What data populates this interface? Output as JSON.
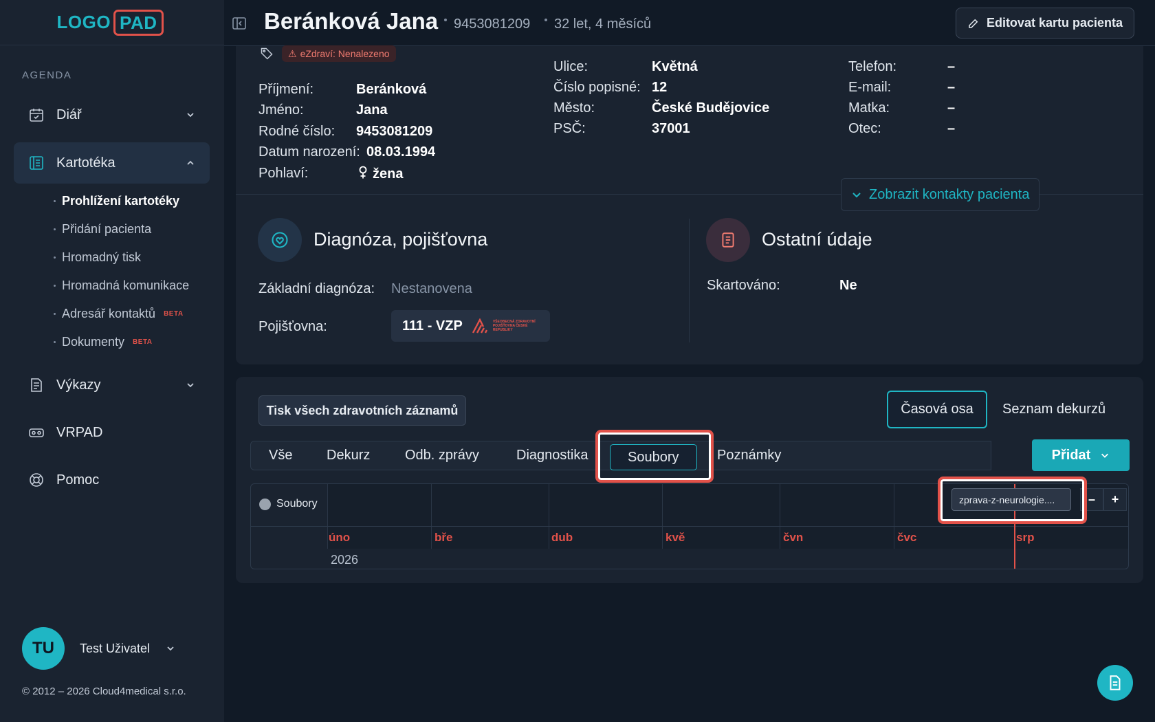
{
  "app": {
    "logo_part1": "LOGO",
    "logo_part2": "PAD"
  },
  "sidebar": {
    "section_label": "AGENDA",
    "items": [
      {
        "label": "Diář",
        "icon": "calendar-icon"
      },
      {
        "label": "Kartotéka",
        "icon": "cardfile-icon"
      },
      {
        "label": "Výkazy",
        "icon": "report-icon"
      },
      {
        "label": "VRPAD",
        "icon": "vr-icon"
      },
      {
        "label": "Pomoc",
        "icon": "lifebuoy-icon"
      }
    ],
    "sub_items": [
      {
        "label": "Prohlížení kartotéky"
      },
      {
        "label": "Přidání pacienta"
      },
      {
        "label": "Hromadný tisk"
      },
      {
        "label": "Hromadná komunikace"
      },
      {
        "label": "Adresář kontaktů",
        "badge": "BETA"
      },
      {
        "label": "Dokumenty",
        "badge": "BETA"
      }
    ],
    "user": {
      "initials": "TU",
      "name": "Test Uživatel"
    },
    "copyright": "© 2012 – 2026 Cloud4medical s.r.o."
  },
  "header": {
    "patient_name": "Beránková Jana",
    "birth_number": "9453081209",
    "age": "32 let, 4 měsíců",
    "edit_label": "Editovat kartu pacienta"
  },
  "patient": {
    "ezdravi": "eZdraví: Nenalezeno",
    "personal": [
      {
        "label": "Příjmení:",
        "value": "Beránková"
      },
      {
        "label": "Jméno:",
        "value": "Jana"
      },
      {
        "label": "Rodné číslo:",
        "value": "9453081209"
      },
      {
        "label": "Datum narození:",
        "value": "08.03.1994"
      },
      {
        "label": "Pohlaví:",
        "value": "žena"
      }
    ],
    "address": [
      {
        "label": "Ulice:",
        "value": "Květná"
      },
      {
        "label": "Číslo popisné:",
        "value": "12"
      },
      {
        "label": "Město:",
        "value": "České Budějovice"
      },
      {
        "label": "PSČ:",
        "value": "37001"
      }
    ],
    "contacts": [
      {
        "label": "Telefon:",
        "value": "–"
      },
      {
        "label": "E-mail:",
        "value": "–"
      },
      {
        "label": "Matka:",
        "value": "–"
      },
      {
        "label": "Otec:",
        "value": "–"
      }
    ],
    "show_contacts_label": "Zobrazit kontakty pacienta"
  },
  "diagnosis": {
    "title": "Diagnóza, pojišťovna",
    "base_label": "Základní diagnóza:",
    "base_value": "Nestanovena",
    "insurance_label": "Pojišťovna:",
    "insurance_value": "111 - VZP",
    "insurance_logo_text": "VŠEOBECNÁ ZDRAVOTNÍ POJIŠŤOVNA ČESKÉ REPUBLIKY"
  },
  "other": {
    "title": "Ostatní údaje",
    "shredded_label": "Skartováno:",
    "shredded_value": "Ne"
  },
  "records": {
    "print_all_label": "Tisk všech zdravotních záznamů",
    "view_modes": [
      "Časová osa",
      "Seznam dekurzů"
    ],
    "tabs": [
      "Vše",
      "Dekurz",
      "Odb. zprávy",
      "Diagnostika",
      "Soubory",
      "Poznámky"
    ],
    "active_tab": "Soubory",
    "add_label": "Přidat"
  },
  "timeline": {
    "lane_label": "Soubory",
    "months": [
      "úno",
      "bře",
      "dub",
      "kvě",
      "čvn",
      "čvc",
      "srp"
    ],
    "year": "2026",
    "file_chip": "zprava-z-neurologie....",
    "zoom_out": "–",
    "zoom_in": "+"
  },
  "colors": {
    "accent": "#1fb6c4",
    "highlight": "#e2524a",
    "background": "#111a26",
    "panel": "#1a2330"
  }
}
